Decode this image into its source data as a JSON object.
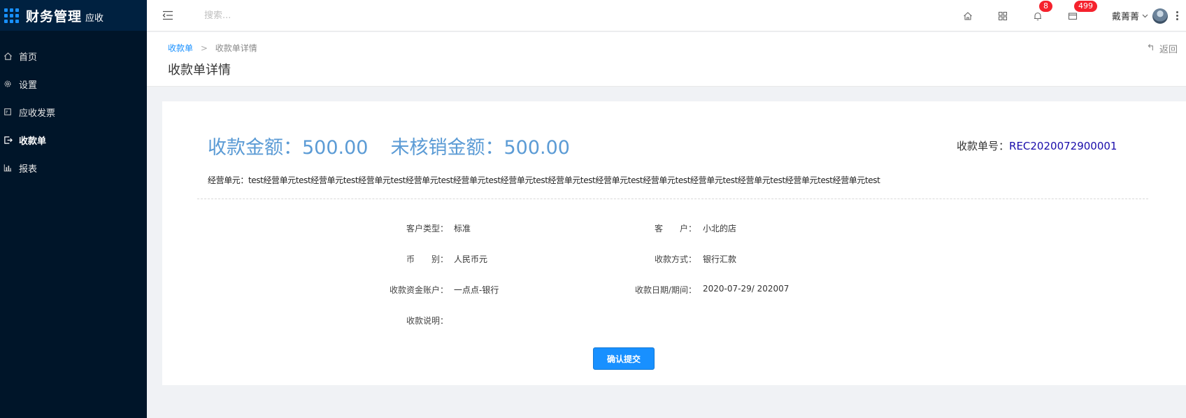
{
  "app": {
    "title": "财务管理",
    "subtitle": "应收"
  },
  "sidebar": {
    "items": [
      {
        "label": "首页",
        "icon": "home-icon"
      },
      {
        "label": "设置",
        "icon": "gear-icon"
      },
      {
        "label": "应收发票",
        "icon": "invoice-icon"
      },
      {
        "label": "收款单",
        "icon": "receipt-icon",
        "active": true
      },
      {
        "label": "报表",
        "icon": "bar-chart-icon"
      }
    ]
  },
  "header": {
    "search_placeholder": "搜索...",
    "notifications_count": "8",
    "messages_count": "499",
    "user_name": "戴菁菁"
  },
  "page": {
    "breadcrumb": {
      "parent": "收款单",
      "separator": ">",
      "current": "收款单详情"
    },
    "title": "收款单详情",
    "back_label": "返回"
  },
  "detail": {
    "amount_text": "收款金额：500.00",
    "unwritten_text": "未核销金额：500.00",
    "receipt_no_label": "收款单号：",
    "receipt_no": "REC2020072900001",
    "biz_unit_text": "经营单元：test经营单元test经营单元test经营单元test经营单元test经营单元test经营单元test经营单元test经营单元test经营单元test经营单元test经营单元test经营单元test经营单元test",
    "fields": {
      "customer_type_label": "客户类型：",
      "customer_type": "标准",
      "customer_label": "客　　户：",
      "customer": "小北的店",
      "currency_label": "币　　别：",
      "currency": "人民币元",
      "method_label": "收款方式：",
      "method": "银行汇款",
      "account_label": "收款资金账户：",
      "account": "一点点-银行",
      "date_label": "收款日期/期间：",
      "date": "2020-07-29/ 202007",
      "note_label": "收款说明：",
      "note": ""
    },
    "submit_label": "确认提交"
  },
  "colors": {
    "sidebar_bg": "#001529",
    "accent": "#1890ff",
    "amount": "#5b9bd5",
    "badge": "#f5222d"
  }
}
